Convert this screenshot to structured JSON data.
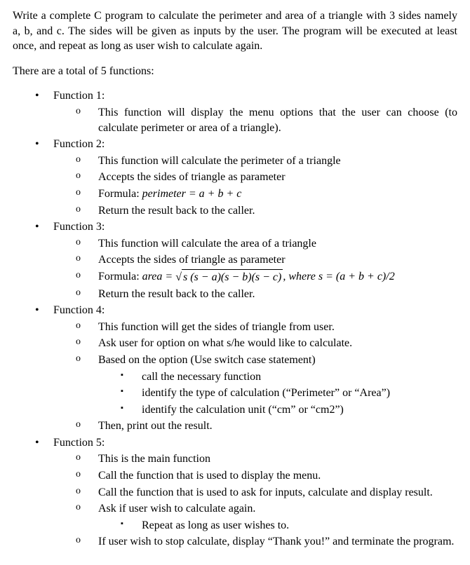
{
  "intro": "Write a complete C program to calculate the perimeter and area of a triangle with 3 sides namely a, b, and c. The sides will be given as inputs by the user. The program will be executed at least once, and repeat as long as user wish to calculate again.",
  "total": "There are a total of 5 functions:",
  "f1": {
    "title": "Function 1:",
    "p1": "This function will display the menu options that the user can choose (to calculate perimeter or area of a triangle)."
  },
  "f2": {
    "title": "Function 2:",
    "p1": "This function will calculate the perimeter of a triangle",
    "p2": "Accepts the sides of triangle as parameter",
    "p3_label": "Formula: ",
    "p3_word": "perimeter",
    "p3_eq": " = a + b + c",
    "p4": "Return the result back to the caller."
  },
  "f3": {
    "title": "Function 3:",
    "p1": "This function will calculate the area of a triangle",
    "p2": "Accepts the sides of triangle as parameter",
    "p3_label": "Formula: ",
    "p3_word": "area",
    "p3_eq_pre": " = ",
    "p3_radicand": "s (s − a)(s − b)(s − c)",
    "p3_where": ", where s = (a + b + c)/2",
    "p4": "Return the result back to the caller."
  },
  "f4": {
    "title": "Function 4:",
    "p1": "This function will get the sides of triangle from user.",
    "p2": "Ask user for option on what s/he would like to calculate.",
    "p3": "Based on the option (Use switch case statement)",
    "s1": "call the necessary function",
    "s2": "identify the type of calculation (“Perimeter” or “Area”)",
    "s3": "identify the calculation unit (“cm” or “cm2”)",
    "p4": "Then, print out the result."
  },
  "f5": {
    "title": "Function 5:",
    "p1": "This is the main function",
    "p2": "Call the function that is used to display the menu.",
    "p3": "Call the function that is used to ask for inputs, calculate and display result.",
    "p4": "Ask if user wish to calculate again.",
    "s1": "Repeat as long as user wishes to.",
    "p5": "If user wish to stop calculate, display “Thank you!” and terminate the program."
  }
}
